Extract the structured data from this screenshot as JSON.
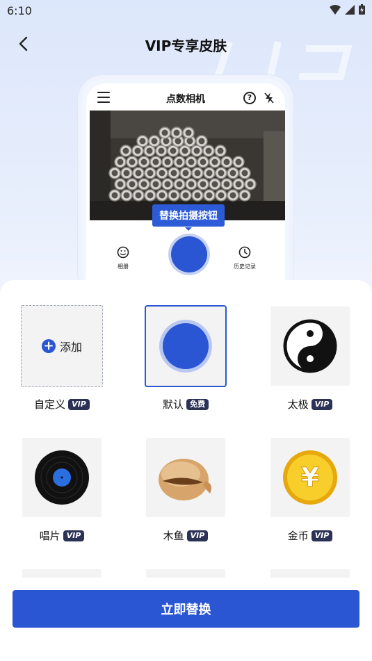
{
  "status": {
    "time": "6:10"
  },
  "header": {
    "title": "VIP专享皮肤"
  },
  "preview": {
    "app_title": "点数相机",
    "help_glyph": "?",
    "tooltip": "替换拍摄按钮",
    "album_label": "相册",
    "history_label": "历史记录"
  },
  "skins": [
    {
      "label": "自定义",
      "badge": "VIP",
      "type": "add",
      "add_text": "添加"
    },
    {
      "label": "默认",
      "badge": "免费",
      "type": "default",
      "selected": true
    },
    {
      "label": "太极",
      "badge": "VIP",
      "type": "taiji"
    },
    {
      "label": "唱片",
      "badge": "VIP",
      "type": "record"
    },
    {
      "label": "木鱼",
      "badge": "VIP",
      "type": "muyu"
    },
    {
      "label": "金币",
      "badge": "VIP",
      "type": "coin"
    }
  ],
  "cta": {
    "label": "立即替换"
  },
  "colors": {
    "accent": "#2a55d3",
    "badge_bg": "#2b3256",
    "coin": "#f3c217"
  }
}
